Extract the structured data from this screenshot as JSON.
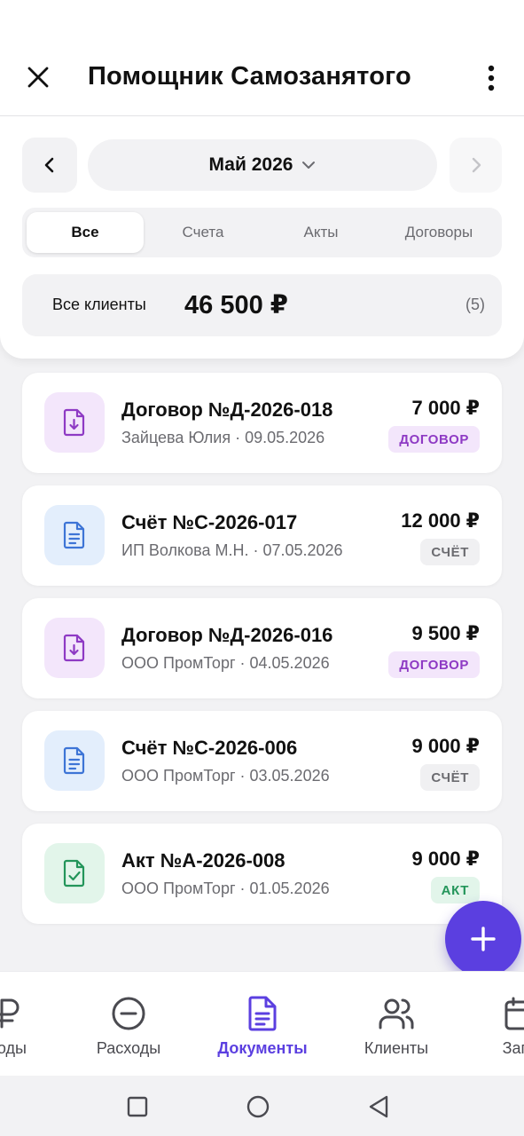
{
  "app": {
    "title": "Помощник Самозанятого"
  },
  "period": {
    "month_label": "Май 2026"
  },
  "tabs": [
    {
      "label": "Все",
      "active": true
    },
    {
      "label": "Счета",
      "active": false
    },
    {
      "label": "Акты",
      "active": false
    },
    {
      "label": "Договоры",
      "active": false
    }
  ],
  "summary": {
    "label": "Все клиенты",
    "amount": "46 500 ₽",
    "count": "(5)"
  },
  "documents": [
    {
      "title": "Договор №Д-2026-018",
      "subtitle": "Зайцева Юлия · 09.05.2026",
      "amount": "7 000 ₽",
      "badge": "ДОГОВОР",
      "kind": "contract",
      "icon": "file-download-icon"
    },
    {
      "title": "Счёт №С-2026-017",
      "subtitle": "ИП Волкова М.Н. · 07.05.2026",
      "amount": "12 000 ₽",
      "badge": "СЧЁТ",
      "kind": "invoice",
      "icon": "file-text-icon"
    },
    {
      "title": "Договор №Д-2026-016",
      "subtitle": "ООО ПромТорг · 04.05.2026",
      "amount": "9 500 ₽",
      "badge": "ДОГОВОР",
      "kind": "contract",
      "icon": "file-download-icon"
    },
    {
      "title": "Счёт №С-2026-006",
      "subtitle": "ООО ПромТорг · 03.05.2026",
      "amount": "9 000 ₽",
      "badge": "СЧЁТ",
      "kind": "invoice",
      "icon": "file-text-icon"
    },
    {
      "title": "Акт №А-2026-008",
      "subtitle": "ООО ПромТорг · 01.05.2026",
      "amount": "9 000 ₽",
      "badge": "АКТ",
      "kind": "act",
      "icon": "file-check-icon"
    }
  ],
  "bottom_nav": [
    {
      "label": "ходы",
      "icon": "ruble-icon",
      "active": false
    },
    {
      "label": "Расходы",
      "icon": "minus-circle-icon",
      "active": false
    },
    {
      "label": "Документы",
      "icon": "document-icon",
      "active": true
    },
    {
      "label": "Клиенты",
      "icon": "users-icon",
      "active": false
    },
    {
      "label": "Запи",
      "icon": "calendar-icon",
      "active": false
    }
  ],
  "colors": {
    "accent": "#5b3fe0",
    "contract_bg": "#f3e6fb",
    "contract_fg": "#8e3ac4",
    "invoice_bg": "#e3eefc",
    "invoice_fg": "#3d74d6",
    "act_bg": "#e2f5ea",
    "act_fg": "#23955a",
    "invoice_badge_bg": "#f0f0f2",
    "invoice_badge_fg": "#6b6b70"
  }
}
